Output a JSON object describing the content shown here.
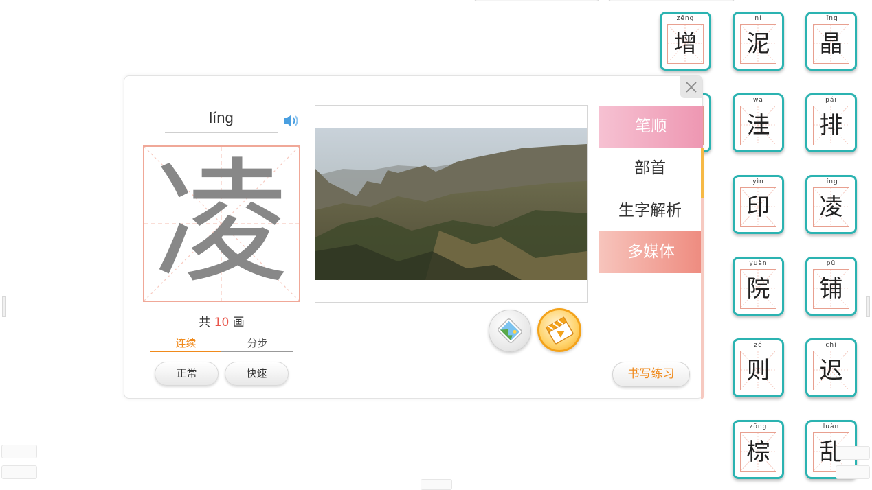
{
  "lesson": {
    "pinyin": "líng",
    "character": "凌",
    "stroke_prefix": "共",
    "stroke_count": "10",
    "stroke_suffix": "画",
    "mode_tabs": [
      "连续",
      "分步"
    ],
    "speed_buttons": [
      "正常",
      "快速"
    ]
  },
  "side_menu": {
    "items": [
      "笔顺",
      "部首",
      "生字解析",
      "多媒体"
    ],
    "practice_label": "书写练习"
  },
  "cards": [
    {
      "pinyin": "zēng",
      "char": "增"
    },
    {
      "pinyin": "ní",
      "char": "泥"
    },
    {
      "pinyin": "jīng",
      "char": "晶"
    },
    {
      "pinyin": "wā",
      "char": "洼"
    },
    {
      "pinyin": "pái",
      "char": "排"
    },
    {
      "pinyin": "yìn",
      "char": "印"
    },
    {
      "pinyin": "líng",
      "char": "凌"
    },
    {
      "pinyin": "yuàn",
      "char": "院"
    },
    {
      "pinyin": "pū",
      "char": "铺"
    },
    {
      "pinyin": "zé",
      "char": "则"
    },
    {
      "pinyin": "chí",
      "char": "迟"
    },
    {
      "pinyin": "zōng",
      "char": "棕"
    },
    {
      "pinyin": "luàn",
      "char": "乱"
    }
  ],
  "icons": {
    "speaker": "speaker-icon",
    "close": "close-icon",
    "image": "image-icon",
    "video": "video-clapper-icon"
  },
  "colors": {
    "card_border": "#2bb3b1",
    "accent_orange": "#f08a1c",
    "stroke_number": "#e9554a",
    "grid_line": "#f0a898"
  }
}
